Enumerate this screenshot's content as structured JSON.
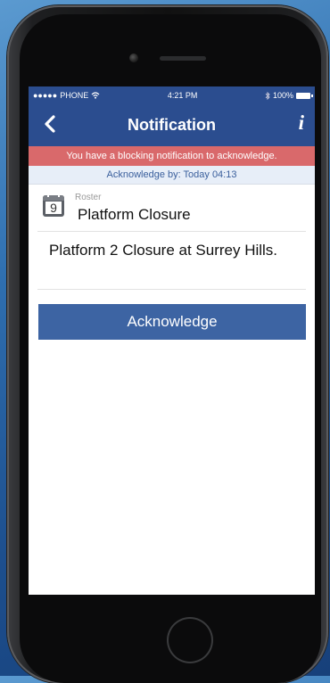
{
  "status_bar": {
    "carrier": "PHONE",
    "signal_icon": "signal-dots-icon",
    "wifi_icon": "wifi-icon",
    "time": "4:21 PM",
    "bluetooth_icon": "bluetooth-icon",
    "battery_percent": "100%",
    "battery_icon": "battery-icon"
  },
  "nav": {
    "title": "Notification",
    "back_icon": "chevron-left-icon",
    "info_label": "i"
  },
  "banner": {
    "text": "You have a blocking notification to acknowledge.",
    "ack_by": "Acknowledge by: Today 04:13"
  },
  "notification": {
    "category": "Roster",
    "calendar_day": "9",
    "title": "Platform Closure",
    "message": "Platform 2 Closure at Surrey Hills."
  },
  "actions": {
    "acknowledge_label": "Acknowledge"
  },
  "colors": {
    "nav_bar": "#2b4d8f",
    "alert": "#d9696b",
    "button": "#3d64a3",
    "ack_by_bg": "#e7eef8"
  }
}
